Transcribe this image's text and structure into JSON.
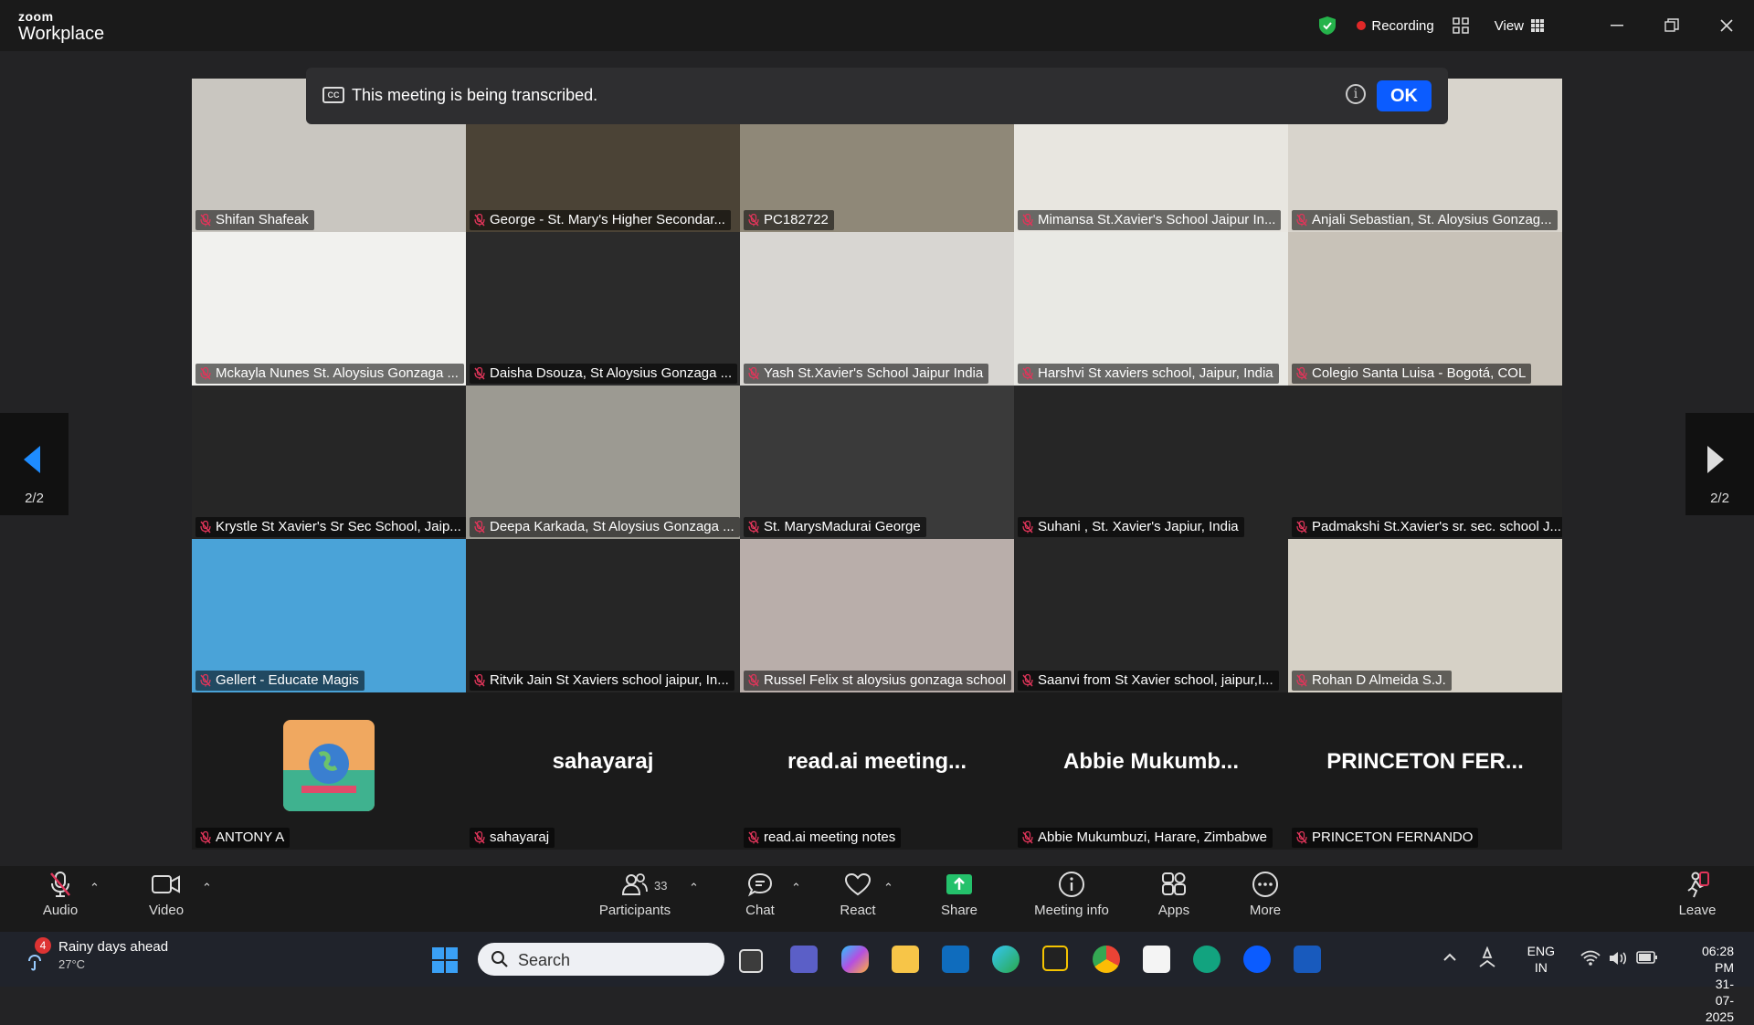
{
  "app": {
    "brand_small": "zoom",
    "brand_big": "Workplace",
    "recording": "Recording",
    "view": "View"
  },
  "banner": {
    "message": "This meeting is being transcribed.",
    "cc": "CC",
    "ok": "OK"
  },
  "pagination": {
    "left": "2/2",
    "right": "2/2"
  },
  "participants_grid": [
    {
      "name": "Shifan Shafeak",
      "bg": "#c9c6c0"
    },
    {
      "name": "George - St. Mary's Higher Secondar...",
      "bg": "#4b4336"
    },
    {
      "name": "PC182722",
      "bg": "#8f8878"
    },
    {
      "name": "Mimansa St.Xavier's School Jaipur In...",
      "bg": "#e8e6e0"
    },
    {
      "name": "Anjali Sebastian, St. Aloysius Gonzag...",
      "bg": "#d8d4cc"
    },
    {
      "name": "Mckayla Nunes St. Aloysius Gonzaga ...",
      "bg": "#f1f1ee"
    },
    {
      "name": "Daisha Dsouza, St Aloysius Gonzaga ...",
      "bg": "#2b2b2b"
    },
    {
      "name": "Yash St.Xavier's School Jaipur India",
      "bg": "#d8d6d2"
    },
    {
      "name": "Harshvi St xaviers school, Jaipur, India",
      "bg": "#e9e9e4"
    },
    {
      "name": "Colegio Santa Luisa - Bogotá, COL",
      "bg": "#c8c2b8"
    },
    {
      "name": "Krystle St Xavier's Sr Sec School, Jaip...",
      "bg": "#262626"
    },
    {
      "name": "Deepa Karkada, St Aloysius Gonzaga ...",
      "bg": "#9c9a92"
    },
    {
      "name": "St. MarysMadurai George",
      "bg": "#3a3a3a"
    },
    {
      "name": "Suhani , St. Xavier's Japiur, India",
      "bg": "#262626"
    },
    {
      "name": "Padmakshi St.Xavier's sr. sec. school J...",
      "bg": "#262626"
    },
    {
      "name": "Gellert - Educate Magis",
      "bg": "#4aa3d8"
    },
    {
      "name": "Ritvik Jain St Xaviers school jaipur, In...",
      "bg": "#262626"
    },
    {
      "name": "Russel Felix st aloysius gonzaga school",
      "bg": "#b9aeaa"
    },
    {
      "name": "Saanvi from St Xavier school, jaipur,I...",
      "bg": "#262626"
    },
    {
      "name": "Rohan D Almeida S.J.",
      "bg": "#d6d1c6"
    }
  ],
  "bottom_row": [
    {
      "big": "",
      "name": "ANTONY A"
    },
    {
      "big": "sahayaraj",
      "name": "sahayaraj"
    },
    {
      "big": "read.ai meeting...",
      "name": "read.ai meeting notes"
    },
    {
      "big": "Abbie Mukumb...",
      "name": "Abbie Mukumbuzi, Harare, Zimbabwe"
    },
    {
      "big": "PRINCETON FER...",
      "name": "PRINCETON FERNANDO"
    }
  ],
  "toolbar": {
    "audio": "Audio",
    "video": "Video",
    "participants": "Participants",
    "participants_count": "33",
    "chat": "Chat",
    "react": "React",
    "share": "Share",
    "meeting_info": "Meeting info",
    "apps": "Apps",
    "more": "More",
    "leave": "Leave"
  },
  "taskbar": {
    "weather_title": "Rainy days ahead",
    "weather_temp": "27°C",
    "weather_badge": "4",
    "search": "Search",
    "lang1": "ENG",
    "lang2": "IN",
    "time": "06:28 PM",
    "date": "31-07-2025"
  },
  "colors": {
    "accent": "#0b5cff",
    "record": "#e02828",
    "share": "#24c16b",
    "mic_off": "#e0355a"
  }
}
